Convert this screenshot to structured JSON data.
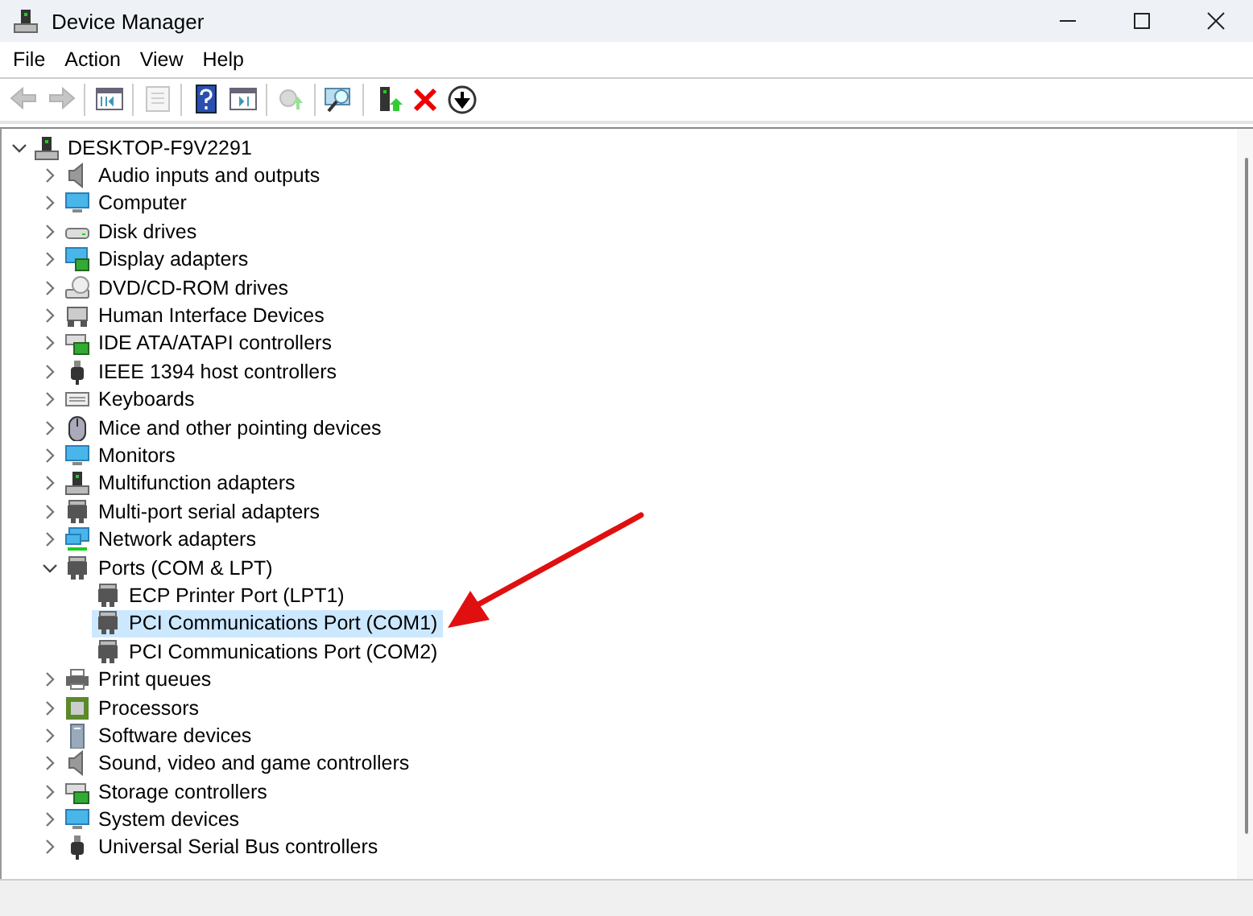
{
  "window": {
    "title": "Device Manager"
  },
  "menu": [
    {
      "label": "File"
    },
    {
      "label": "Action"
    },
    {
      "label": "View"
    },
    {
      "label": "Help"
    }
  ],
  "toolbar": [
    {
      "kind": "back",
      "disabled": true
    },
    {
      "kind": "forward",
      "disabled": true
    },
    {
      "kind": "separator"
    },
    {
      "kind": "console-tree",
      "disabled": false
    },
    {
      "kind": "separator"
    },
    {
      "kind": "properties",
      "disabled": true
    },
    {
      "kind": "separator"
    },
    {
      "kind": "help",
      "disabled": false
    },
    {
      "kind": "action-pane",
      "disabled": false
    },
    {
      "kind": "separator"
    },
    {
      "kind": "update",
      "disabled": true
    },
    {
      "kind": "separator"
    },
    {
      "kind": "scan",
      "disabled": false
    },
    {
      "kind": "separator"
    },
    {
      "kind": "enable",
      "disabled": false
    },
    {
      "kind": "uninstall",
      "disabled": false
    },
    {
      "kind": "disable",
      "disabled": false
    }
  ],
  "tree": {
    "label": "DESKTOP-F9V2291",
    "kind": "pc",
    "expanded": true,
    "selected": false,
    "children": [
      {
        "label": "Audio inputs and outputs",
        "kind": "speaker",
        "expanded": false,
        "selected": false
      },
      {
        "label": "Computer",
        "kind": "monitor",
        "expanded": false,
        "selected": false
      },
      {
        "label": "Disk drives",
        "kind": "drive",
        "expanded": false,
        "selected": false
      },
      {
        "label": "Display adapters",
        "kind": "display-card",
        "expanded": false,
        "selected": false
      },
      {
        "label": "DVD/CD-ROM drives",
        "kind": "disc",
        "expanded": false,
        "selected": false
      },
      {
        "label": "Human Interface Devices",
        "kind": "hid",
        "expanded": false,
        "selected": false
      },
      {
        "label": "IDE ATA/ATAPI controllers",
        "kind": "card",
        "expanded": false,
        "selected": false
      },
      {
        "label": "IEEE 1394 host controllers",
        "kind": "plug",
        "expanded": false,
        "selected": false
      },
      {
        "label": "Keyboards",
        "kind": "keyboard",
        "expanded": false,
        "selected": false
      },
      {
        "label": "Mice and other pointing devices",
        "kind": "mouse",
        "expanded": false,
        "selected": false
      },
      {
        "label": "Monitors",
        "kind": "monitor",
        "expanded": false,
        "selected": false
      },
      {
        "label": "Multifunction adapters",
        "kind": "pc",
        "expanded": false,
        "selected": false
      },
      {
        "label": "Multi-port serial adapters",
        "kind": "port",
        "expanded": false,
        "selected": false
      },
      {
        "label": "Network adapters",
        "kind": "network",
        "expanded": false,
        "selected": false
      },
      {
        "label": "Ports (COM & LPT)",
        "kind": "port",
        "expanded": true,
        "selected": false,
        "children": [
          {
            "label": "ECP Printer Port (LPT1)",
            "kind": "port",
            "selected": false
          },
          {
            "label": "PCI Communications Port (COM1)",
            "kind": "port",
            "selected": true
          },
          {
            "label": "PCI Communications Port (COM2)",
            "kind": "port",
            "selected": false
          }
        ]
      },
      {
        "label": "Print queues",
        "kind": "printer",
        "expanded": false,
        "selected": false
      },
      {
        "label": "Processors",
        "kind": "chip",
        "expanded": false,
        "selected": false
      },
      {
        "label": "Software devices",
        "kind": "tower",
        "expanded": false,
        "selected": false
      },
      {
        "label": "Sound, video and game controllers",
        "kind": "speaker",
        "expanded": false,
        "selected": false
      },
      {
        "label": "Storage controllers",
        "kind": "card",
        "expanded": false,
        "selected": false
      },
      {
        "label": "System devices",
        "kind": "monitor",
        "expanded": false,
        "selected": false
      },
      {
        "label": "Universal Serial Bus controllers",
        "kind": "plug",
        "expanded": false,
        "selected": false
      }
    ]
  }
}
